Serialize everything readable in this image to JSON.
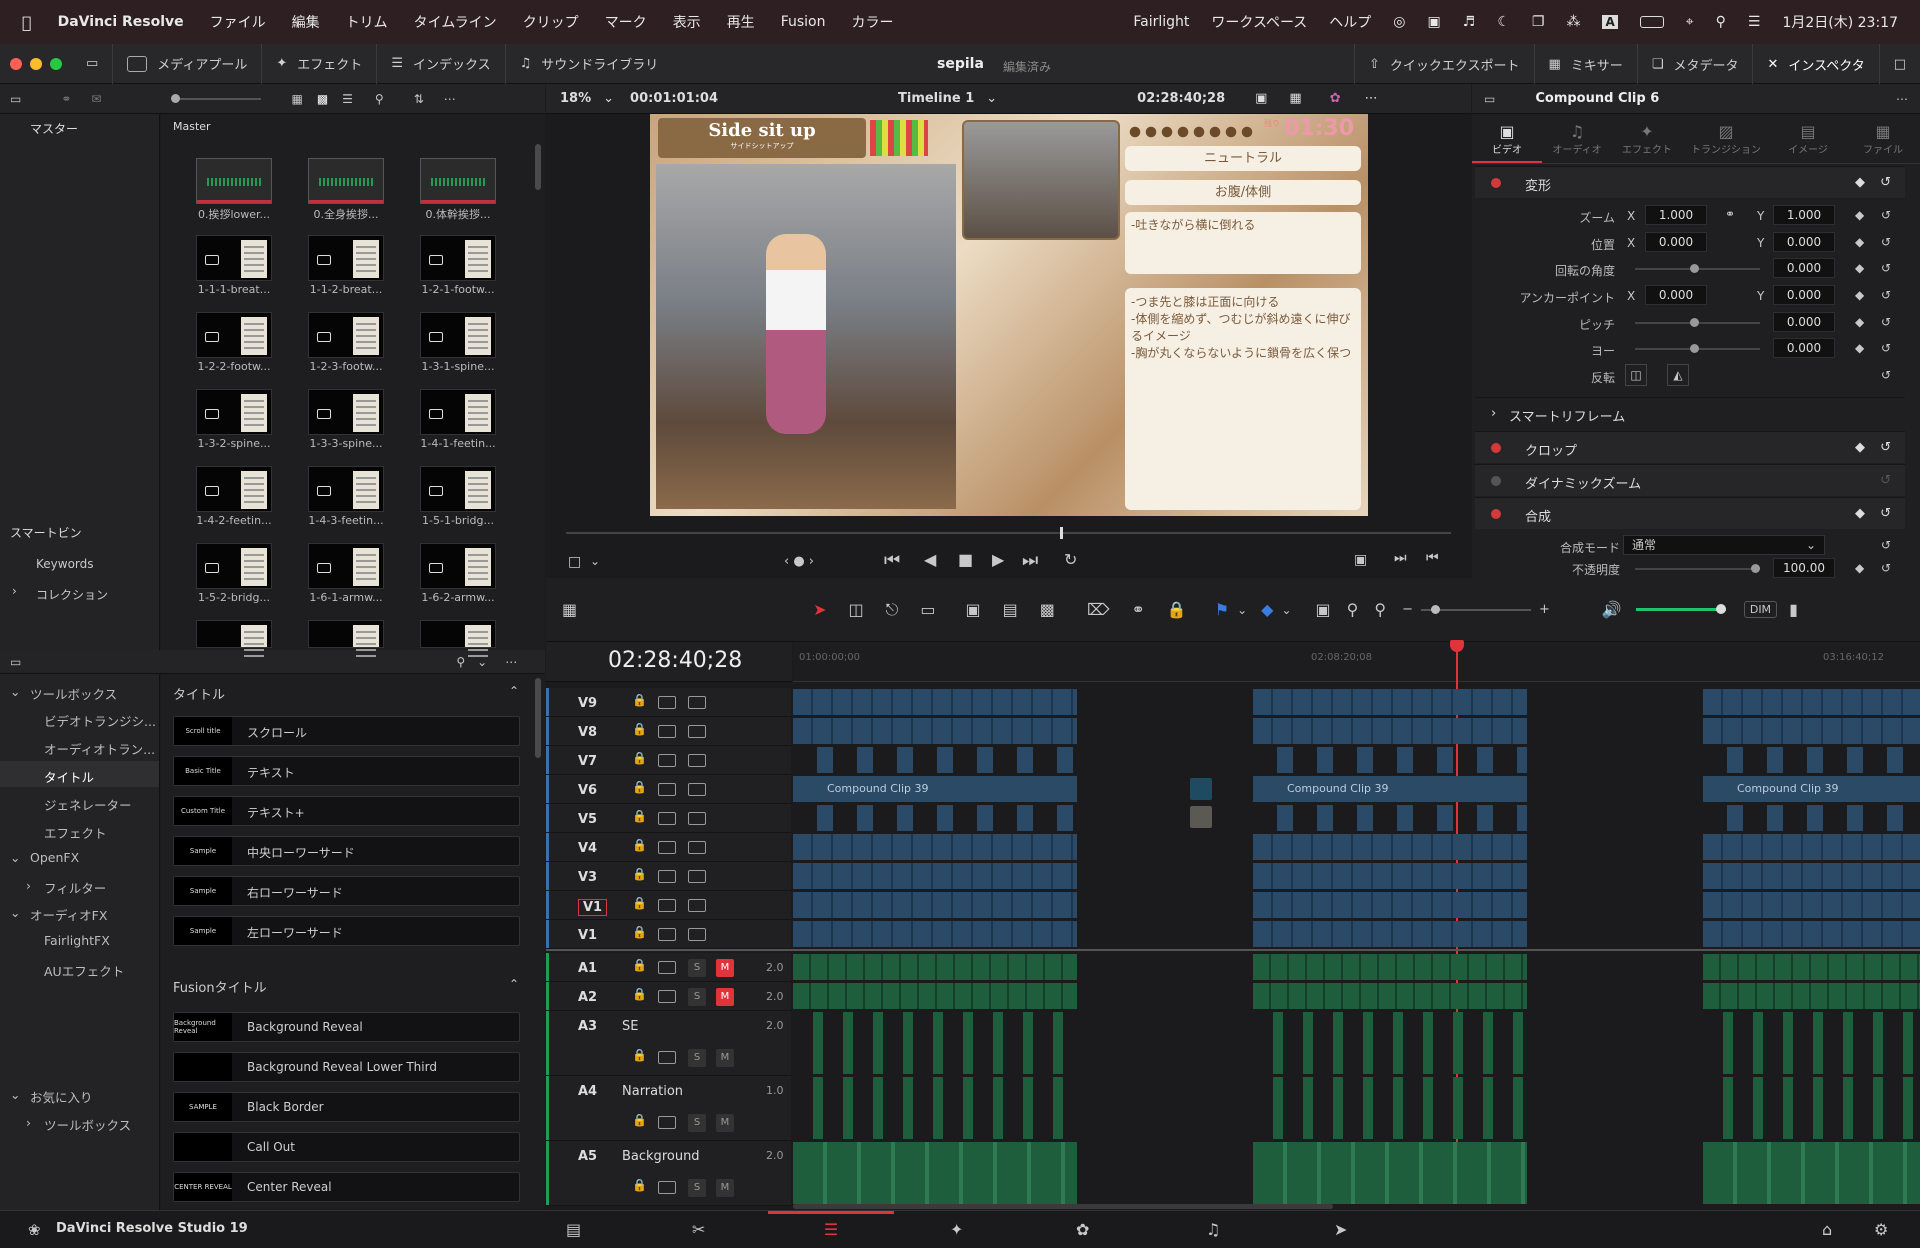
{
  "menubar": {
    "app": "DaVinci Resolve",
    "menus": [
      "ファイル",
      "編集",
      "トリム",
      "タイムライン",
      "クリップ",
      "マーク",
      "表示",
      "再生",
      "Fusion",
      "カラー"
    ],
    "right_menus": [
      "Fairlight",
      "ワークスペース",
      "ヘルプ"
    ],
    "datetime": "1月2日(木)  23:17"
  },
  "toolbar": {
    "media_pool": "メディアプール",
    "effects": "エフェクト",
    "index": "インデックス",
    "sound_library": "サウンドライブラリ",
    "project": "sepila",
    "status": "編集済み",
    "quick_export": "クイックエクスポート",
    "mixer": "ミキサー",
    "metadata": "メタデータ",
    "inspector": "インスペクタ"
  },
  "media": {
    "bin_master": "マスター",
    "bin_header": "Master",
    "smart_bins": "スマートビン",
    "keywords": "Keywords",
    "collections": "コレクション",
    "clips": [
      "0.挨拶lower...",
      "0.全身挨拶...",
      "0.体幹挨拶...",
      "1-1-1-breat...",
      "1-1-2-breat...",
      "1-2-1-footw...",
      "1-2-2-footw...",
      "1-2-3-footw...",
      "1-3-1-spine...",
      "1-3-2-spine...",
      "1-3-3-spine...",
      "1-4-1-feetin...",
      "1-4-2-feetin...",
      "1-4-3-feetin...",
      "1-5-1-bridg...",
      "1-5-2-bridg...",
      "1-6-1-armw...",
      "1-6-2-armw..."
    ]
  },
  "effects": {
    "toolbox": "ツールボックス",
    "tree": [
      "ビデオトランジシ...",
      "オーディオトラン...",
      "タイトル",
      "ジェネレーター",
      "エフェクト"
    ],
    "openfx": "OpenFX",
    "filters": "フィルター",
    "audiofx": "オーディオFX",
    "fairlightfx": "FairlightFX",
    "au": "AUエフェクト",
    "favorites": "お気に入り",
    "fav_toolbox": "ツールボックス",
    "titles_header": "タイトル",
    "titles": [
      {
        "thumb": "Scroll title",
        "name": "スクロール"
      },
      {
        "thumb": "Basic Title",
        "name": "テキスト"
      },
      {
        "thumb": "Custom Title",
        "name": "テキスト+"
      },
      {
        "thumb": "Sample",
        "name": "中央ローワーサード"
      },
      {
        "thumb": "Sample",
        "name": "右ローワーサード"
      },
      {
        "thumb": "Sample",
        "name": "左ローワーサード"
      }
    ],
    "fusion_header": "Fusionタイトル",
    "fusion": [
      {
        "thumb": "Background Reveal",
        "name": "Background Reveal"
      },
      {
        "thumb": "",
        "name": "Background Reveal Lower Third"
      },
      {
        "thumb": "SAMPLE",
        "name": "Black Border"
      },
      {
        "thumb": "",
        "name": "Call Out"
      },
      {
        "thumb": "CENTER REVEAL",
        "name": "Center Reveal"
      }
    ]
  },
  "viewer": {
    "zoom": "18%",
    "source_tc": "00:01:01:04",
    "timeline_name": "Timeline 1",
    "tc": "02:28:40;28",
    "overlay": {
      "title": "Side sit up",
      "subtitle": "サイドシットアップ",
      "remaining_label": "残り",
      "remaining": "01:30",
      "box1": "ニュートラル",
      "box2": "お腹/体側",
      "box3": "-吐きながら横に倒れる",
      "box4": "-つま先と膝は正面に向ける\n-体側を縮めず、つむじが斜め遠くに伸びるイメージ\n-胸が丸くならないように鎖骨を広く保つ"
    }
  },
  "timeline": {
    "timecode": "02:28:40;28",
    "ruler": [
      "01:00:00;00",
      "02:08:20;08",
      "03:16:40;12"
    ],
    "video_tracks": [
      "V9",
      "V8",
      "V7",
      "V6",
      "V5",
      "V4",
      "V3",
      "V1",
      "V1"
    ],
    "audio_tracks": [
      {
        "id": "A1",
        "name": "",
        "level": "2.0"
      },
      {
        "id": "A2",
        "name": "",
        "level": "2.0"
      },
      {
        "id": "A3",
        "name": "SE",
        "level": "2.0"
      },
      {
        "id": "A4",
        "name": "Narration",
        "level": "1.0"
      },
      {
        "id": "A5",
        "name": "Background",
        "level": "2.0"
      }
    ],
    "compound_clip": "Compound Clip 39",
    "dim": "DIM"
  },
  "inspector": {
    "clip": "Compound Clip 6",
    "tabs": [
      "ビデオ",
      "オーディオ",
      "エフェクト",
      "トランジション",
      "イメージ",
      "ファイル"
    ],
    "transform": "変形",
    "zoom": {
      "label": "ズーム",
      "x": "1.000",
      "y": "1.000"
    },
    "position": {
      "label": "位置",
      "x": "0.000",
      "y": "0.000"
    },
    "rotation": {
      "label": "回転の角度",
      "v": "0.000"
    },
    "anchor": {
      "label": "アンカーポイント",
      "x": "0.000",
      "y": "0.000"
    },
    "pitch": {
      "label": "ピッチ",
      "v": "0.000"
    },
    "yaw": {
      "label": "ヨー",
      "v": "0.000"
    },
    "flip": "反転",
    "smart_reframe": "スマートリフレーム",
    "crop": "クロップ",
    "dynamic_zoom": "ダイナミックズーム",
    "composite": "合成",
    "composite_mode_label": "合成モード",
    "composite_mode": "通常",
    "opacity_label": "不透明度",
    "opacity": "100.00",
    "x_label": "X",
    "y_label": "Y"
  },
  "footer": {
    "app": "DaVinci Resolve Studio 19"
  },
  "colors": {
    "accent": "#e0343c",
    "video_clip": "#2b4a68",
    "audio_clip": "#1f5e3d"
  }
}
